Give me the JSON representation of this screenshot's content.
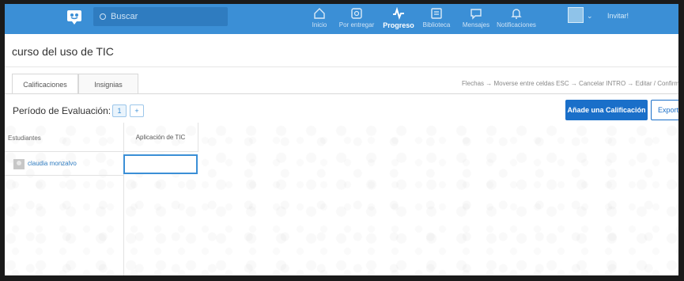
{
  "topbar": {
    "search_placeholder": "Buscar",
    "nav": [
      {
        "label": "Inicio",
        "icon": "home-icon"
      },
      {
        "label": "Por entregar",
        "icon": "inbox-icon"
      },
      {
        "label": "Progreso",
        "icon": "pulse-icon",
        "active": true
      },
      {
        "label": "Biblioteca",
        "icon": "library-icon"
      },
      {
        "label": "Mensajes",
        "icon": "chat-icon"
      },
      {
        "label": "Notificaciones",
        "icon": "bell-icon"
      }
    ],
    "invite_label": "Invitar!"
  },
  "course": {
    "title": "curso del uso de TIC"
  },
  "tabs": [
    {
      "label": "Calificaciones",
      "active": true
    },
    {
      "label": "Insignias",
      "active": false
    }
  ],
  "shortcuts": "Flechas → Moverse entre celdas   ESC → Cancelar   INTRO → Editar / Confirmar",
  "period": {
    "label": "Período de Evaluación:",
    "current": "1",
    "add": "+"
  },
  "actions": {
    "add_grade": "Añade una Calificación",
    "export": "Exportar"
  },
  "grid": {
    "students_header": "Estudiantes",
    "columns": [
      "Aplicación de TIC"
    ],
    "students": [
      {
        "name": "claudia monzalvo",
        "grades": [
          ""
        ]
      }
    ]
  },
  "colors": {
    "brand": "#3b8fd6",
    "primary_button": "#1a6fc9"
  }
}
